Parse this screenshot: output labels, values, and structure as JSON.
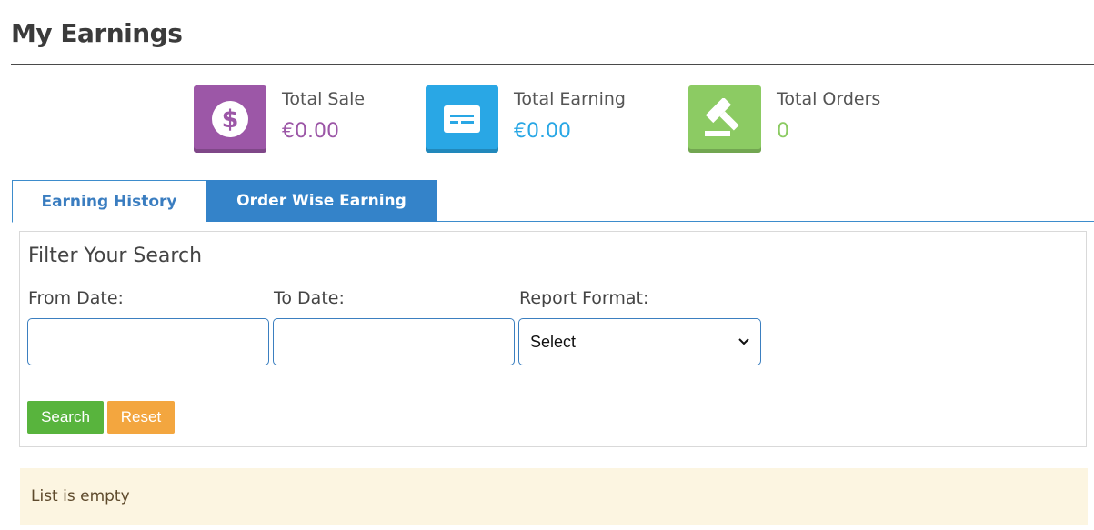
{
  "page": {
    "title": "My Earnings"
  },
  "stats": [
    {
      "label": "Total Sale",
      "value": "€0.00",
      "icon": "dollar-icon",
      "color": "#9c57a7"
    },
    {
      "label": "Total Earning",
      "value": "€0.00",
      "icon": "credit-card-icon",
      "color": "#29a7e5"
    },
    {
      "label": "Total Orders",
      "value": "0",
      "icon": "gavel-icon",
      "color": "#8ccb63"
    }
  ],
  "tabs": [
    {
      "label": "Earning History",
      "active": true
    },
    {
      "label": "Order Wise Earning",
      "active": false
    }
  ],
  "filter": {
    "title": "Filter Your Search",
    "from_date": {
      "label": "From Date:",
      "value": ""
    },
    "to_date": {
      "label": "To Date:",
      "value": ""
    },
    "report_format": {
      "label": "Report Format:",
      "selected": "Select"
    },
    "search_label": "Search",
    "reset_label": "Reset"
  },
  "list": {
    "empty_message": "List is empty"
  }
}
